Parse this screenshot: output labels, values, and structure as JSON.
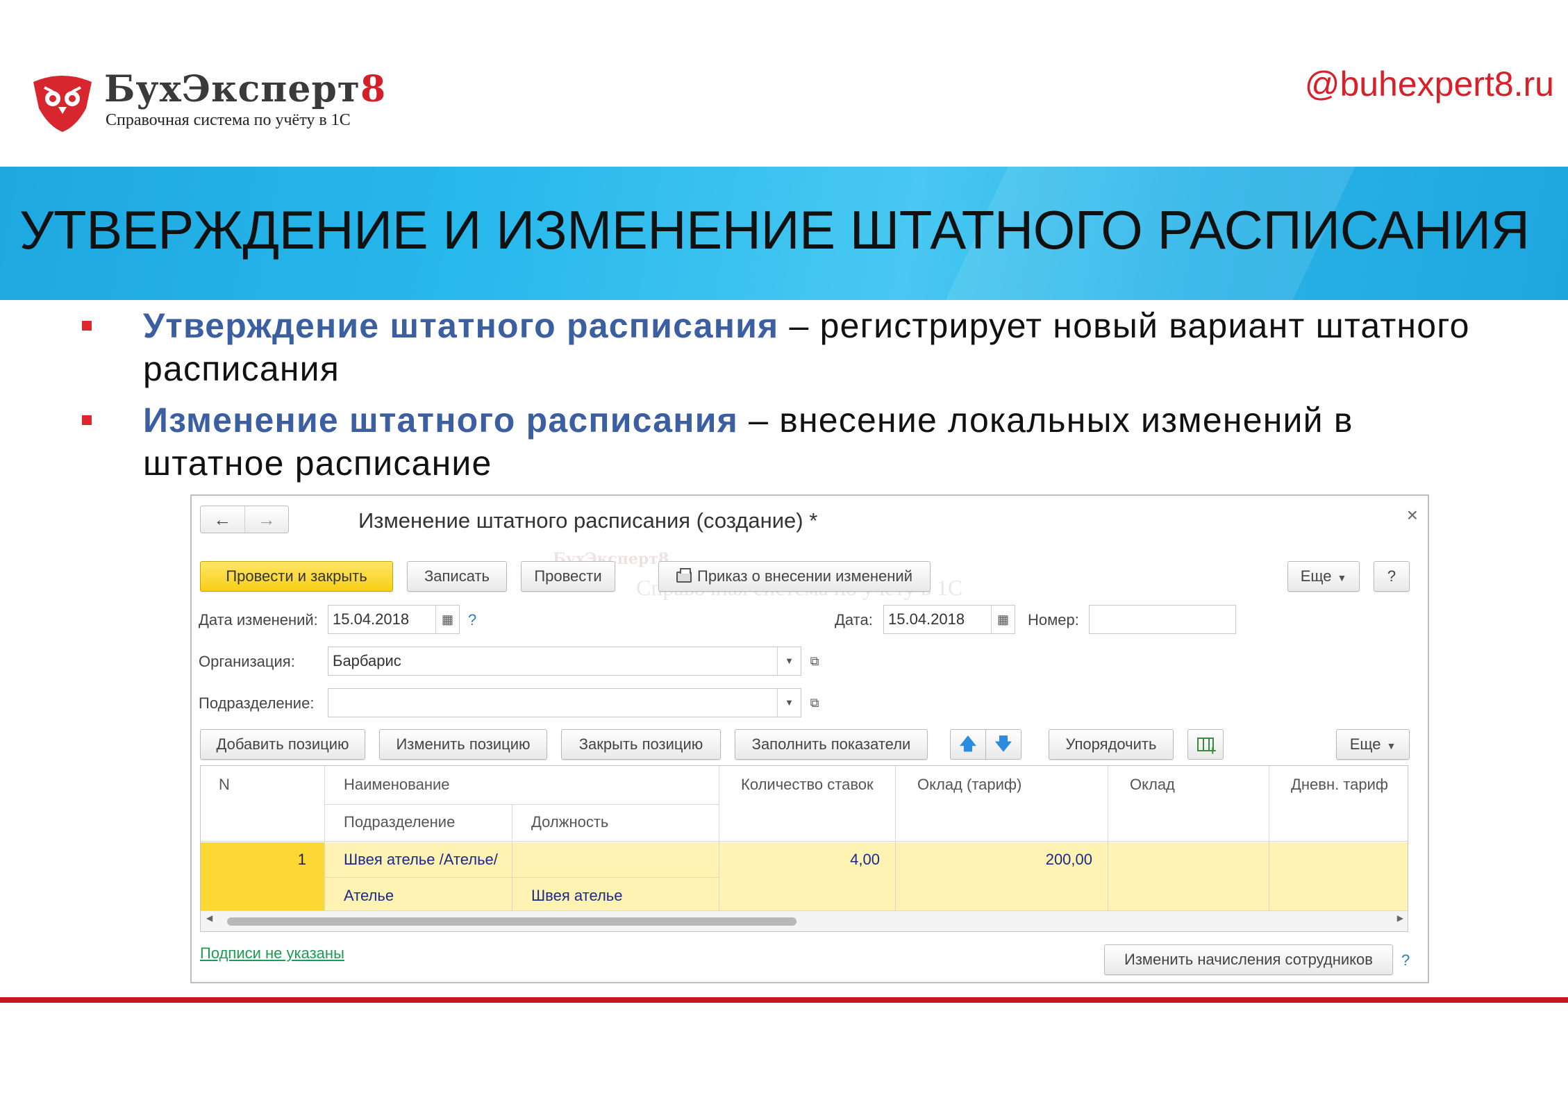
{
  "brand": {
    "name_main": "БухЭксперт",
    "name_digit": "8",
    "subtitle": "Справочная система по учёту в 1С",
    "site": "@buhexpert8.ru"
  },
  "slide": {
    "title": "УТВЕРЖДЕНИЕ И ИЗМЕНЕНИЕ ШТАТНОГО РАСПИСАНИЯ",
    "bullets": [
      {
        "term": "Утверждение штатного расписания",
        "text": " – регистрирует новый вариант штатного расписания"
      },
      {
        "term": "Изменение штатного расписания",
        "text": " – внесение локальных изменений в штатное расписание"
      }
    ]
  },
  "window": {
    "title": "Изменение штатного расписания (создание) *",
    "nav_back": "←",
    "nav_forward": "→",
    "close": "×",
    "toolbar": {
      "post_close": "Провести и закрыть",
      "save": "Записать",
      "post": "Провести",
      "print_order": "Приказ о внесении изменений",
      "more": "Еще",
      "help": "?"
    },
    "form": {
      "change_date_label": "Дата изменений:",
      "change_date_value": "15.04.2018",
      "help_mark": "?",
      "date_label": "Дата:",
      "date_value": "15.04.2018",
      "number_label": "Номер:",
      "number_value": "",
      "org_label": "Организация:",
      "org_value": "Барбарис",
      "dept_label": "Подразделение:",
      "dept_value": ""
    },
    "table_toolbar": {
      "add": "Добавить позицию",
      "edit": "Изменить позицию",
      "close": "Закрыть позицию",
      "fill": "Заполнить показатели",
      "up": "🡅",
      "down": "🡇",
      "sort": "Упорядочить",
      "more": "Еще"
    },
    "table": {
      "headers": {
        "n": "N",
        "name": "Наименование",
        "dept": "Подразделение",
        "position": "Должность",
        "rates": "Количество ставок",
        "salary_rate": "Оклад (тариф)",
        "salary": "Оклад",
        "daily_rate": "Дневн. тариф"
      },
      "rows": [
        {
          "n": "1",
          "name": "Швея ателье /Ателье/",
          "dept": "Ателье",
          "position": "Швея ателье",
          "rates": "4,00",
          "salary_rate": "200,00",
          "salary": "",
          "daily_rate": ""
        }
      ]
    },
    "footer": {
      "signatures": "Подписи не указаны",
      "change_accruals": "Изменить начисления сотрудников",
      "help_mark": "?"
    }
  },
  "colors": {
    "banner": "#27b8ec",
    "brand_red": "#d8202a",
    "bullet_term": "#3b5fa0",
    "primary_button": "#f7cf14",
    "selected_row": "#fff3b3"
  }
}
